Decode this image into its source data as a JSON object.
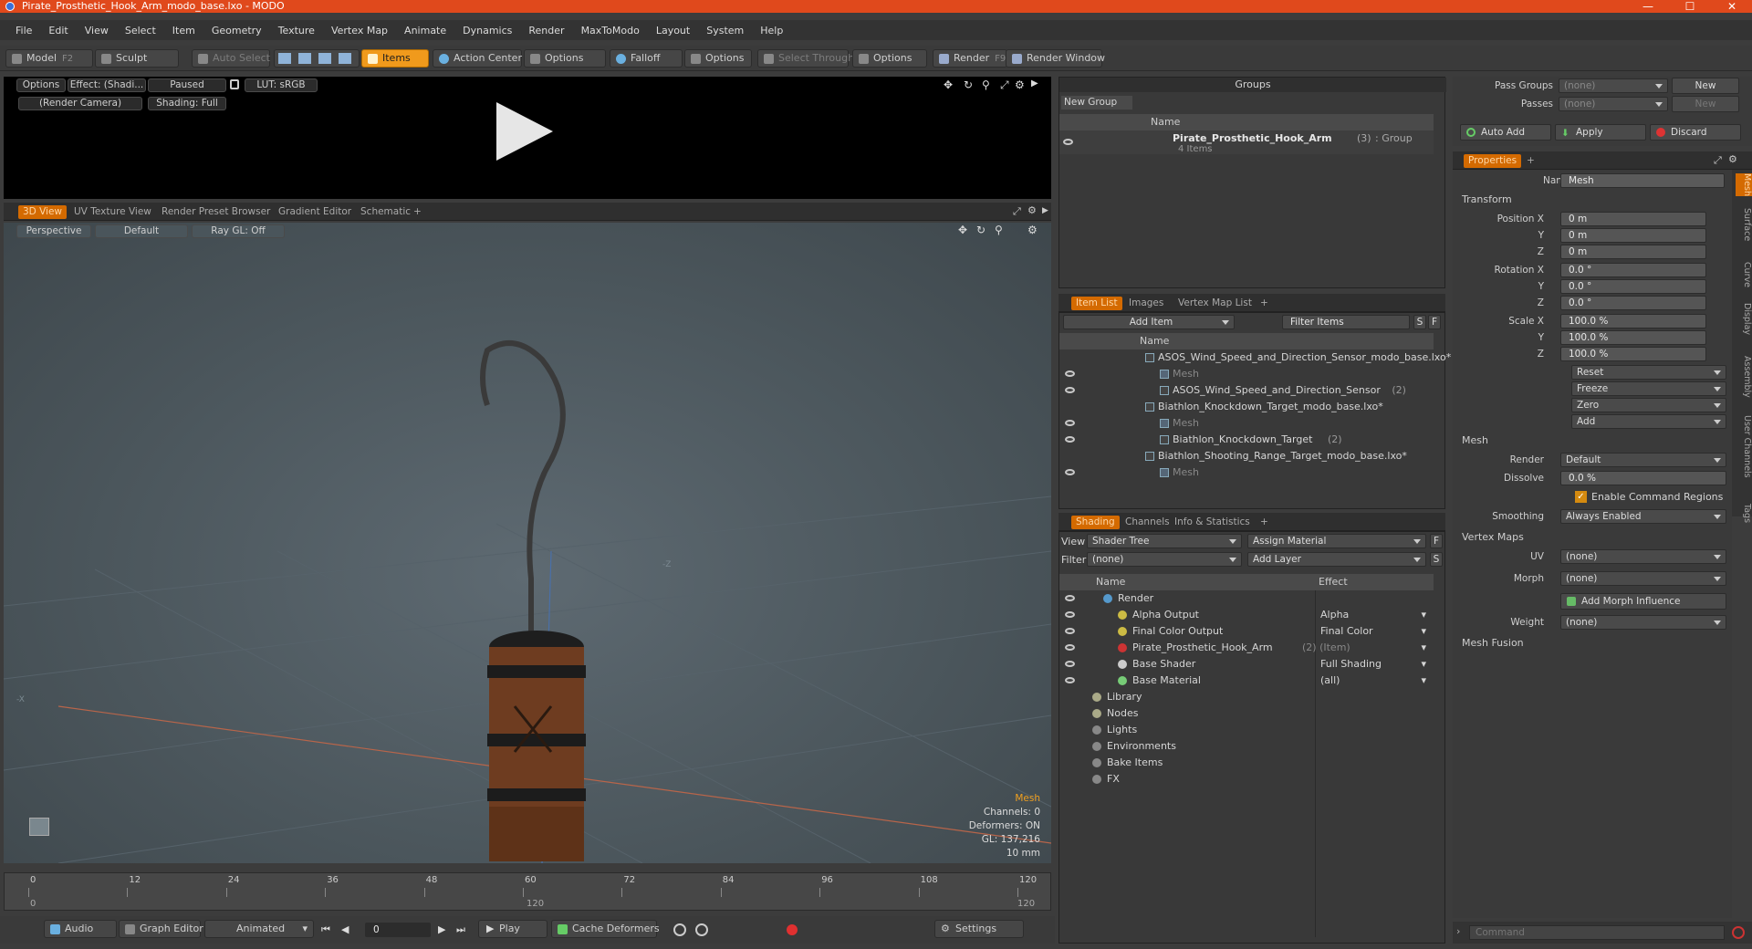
{
  "window": {
    "title": "Pirate_Prosthetic_Hook_Arm_modo_base.lxo - MODO"
  },
  "menu": [
    "File",
    "Edit",
    "View",
    "Select",
    "Item",
    "Geometry",
    "Texture",
    "Vertex Map",
    "Animate",
    "Dynamics",
    "Render",
    "MaxToModo",
    "Layout",
    "System",
    "Help"
  ],
  "toolbar": {
    "model": "Model",
    "model_key": "F2",
    "sculpt": "Sculpt",
    "auto_select": "Auto Select",
    "items": "Items",
    "action_center": "Action Center",
    "options1": "Options",
    "falloff": "Falloff",
    "options2": "Options",
    "select_through": "Select Through",
    "options3": "Options",
    "render": "Render",
    "render_key": "F9",
    "render_window": "Render Window"
  },
  "preview": {
    "options": "Options",
    "effect": "Effect: (Shadi...",
    "paused": "Paused",
    "lut": "LUT: sRGB",
    "camera": "(Render Camera)",
    "shading": "Shading: Full"
  },
  "viewport_tabs": [
    "3D View",
    "UV Texture View",
    "Render Preset Browser",
    "Gradient Editor",
    "Schematic",
    "+"
  ],
  "viewport": {
    "perspective": "Perspective",
    "default": "Default",
    "raygl": "Ray GL: Off",
    "info_title": "Mesh",
    "info_channels": "Channels: 0",
    "info_deformers": "Deformers: ON",
    "info_gl": "GL: 137,216",
    "info_scale": "10 mm",
    "axis_x": "-X",
    "axis_z": "-Z"
  },
  "timeline": {
    "ticks": [
      "0",
      "12",
      "24",
      "36",
      "48",
      "60",
      "72",
      "84",
      "96",
      "108",
      "120"
    ],
    "sub": [
      "0",
      "120",
      "120"
    ]
  },
  "bottombar": {
    "audio": "Audio",
    "graph_editor": "Graph Editor",
    "animated": "Animated",
    "frame": "0",
    "play": "Play",
    "cache": "Cache Deformers",
    "settings": "Settings"
  },
  "groups": {
    "title": "Groups",
    "new_group": "New Group",
    "col_name": "Name",
    "item_name": "Pirate_Prosthetic_Hook_Arm",
    "item_count": "(3)",
    "item_type": ": Group",
    "item_sub": "4 Items"
  },
  "itemlist": {
    "tabs": [
      "Item List",
      "Images",
      "Vertex Map List",
      "+"
    ],
    "add_item": "Add Item",
    "filter": "Filter Items",
    "s": "S",
    "f": "F",
    "col_name": "Name",
    "rows": [
      {
        "label": "ASOS_Wind_Speed_and_Direction_Sensor_modo_base.lxo*",
        "extra": ""
      },
      {
        "label": "Mesh",
        "extra": ""
      },
      {
        "label": "ASOS_Wind_Speed_and_Direction_Sensor",
        "extra": "(2)"
      },
      {
        "label": "Biathlon_Knockdown_Target_modo_base.lxo*",
        "extra": ""
      },
      {
        "label": "Mesh",
        "extra": ""
      },
      {
        "label": "Biathlon_Knockdown_Target",
        "extra": "(2)"
      },
      {
        "label": "Biathlon_Shooting_Range_Target_modo_base.lxo*",
        "extra": ""
      },
      {
        "label": "Mesh",
        "extra": ""
      }
    ]
  },
  "shading": {
    "tabs": [
      "Shading",
      "Channels",
      "Info & Statistics",
      "+"
    ],
    "view_label": "View",
    "view_value": "Shader Tree",
    "assign": "Assign Material",
    "f": "F",
    "filter_label": "Filter",
    "filter_value": "(none)",
    "add_layer": "Add Layer",
    "s": "S",
    "col_name": "Name",
    "col_effect": "Effect",
    "rows": [
      {
        "name": "Render",
        "effect": ""
      },
      {
        "name": "Alpha Output",
        "effect": "Alpha"
      },
      {
        "name": "Final Color Output",
        "effect": "Final Color"
      },
      {
        "name": "Pirate_Prosthetic_Hook_Arm",
        "extra": "(2) (Item)",
        "effect": ""
      },
      {
        "name": "Base Shader",
        "effect": "Full Shading"
      },
      {
        "name": "Base Material",
        "effect": "(all)"
      },
      {
        "name": "Library",
        "effect": ""
      },
      {
        "name": "Nodes",
        "effect": ""
      },
      {
        "name": "Lights",
        "effect": ""
      },
      {
        "name": "Environments",
        "effect": ""
      },
      {
        "name": "Bake Items",
        "effect": ""
      },
      {
        "name": "FX",
        "effect": ""
      }
    ]
  },
  "passes": {
    "pass_groups": "Pass Groups",
    "pass_value": "(none)",
    "new1": "New",
    "passes": "Passes",
    "passes_value": "(none)",
    "new2": "New",
    "auto_add": "Auto Add",
    "apply": "Apply",
    "discard": "Discard"
  },
  "properties": {
    "tab": "Properties",
    "plus": "+",
    "name_label": "Name",
    "name_value": "Mesh",
    "transform": "Transform",
    "pos_x_label": "Position X",
    "pos_x": "0 m",
    "y": "Y",
    "pos_y": "0 m",
    "z": "Z",
    "pos_z": "0 m",
    "rot_x_label": "Rotation X",
    "rot_x": "0.0 °",
    "rot_y": "0.0 °",
    "rot_z": "0.0 °",
    "scale_x_label": "Scale X",
    "scale_x": "100.0 %",
    "scale_y": "100.0 %",
    "scale_z": "100.0 %",
    "reset": "Reset",
    "freeze": "Freeze",
    "zero": "Zero",
    "add": "Add",
    "mesh": "Mesh",
    "render_label": "Render",
    "render_value": "Default",
    "dissolve_label": "Dissolve",
    "dissolve_value": "0.0 %",
    "enable_cmd": "Enable Command Regions",
    "smoothing_label": "Smoothing",
    "smoothing_value": "Always Enabled",
    "vertex_maps": "Vertex Maps",
    "uv_label": "UV",
    "uv_value": "(none)",
    "morph_label": "Morph",
    "morph_value": "(none)",
    "add_morph": "Add Morph Influence",
    "weight_label": "Weight",
    "weight_value": "(none)",
    "mesh_fusion": "Mesh Fusion",
    "side_tabs": [
      "Mesh",
      "Surface",
      "Curve",
      "Display",
      "Assembly",
      "User Channels",
      "Tags"
    ]
  },
  "command": {
    "placeholder": "Command"
  }
}
